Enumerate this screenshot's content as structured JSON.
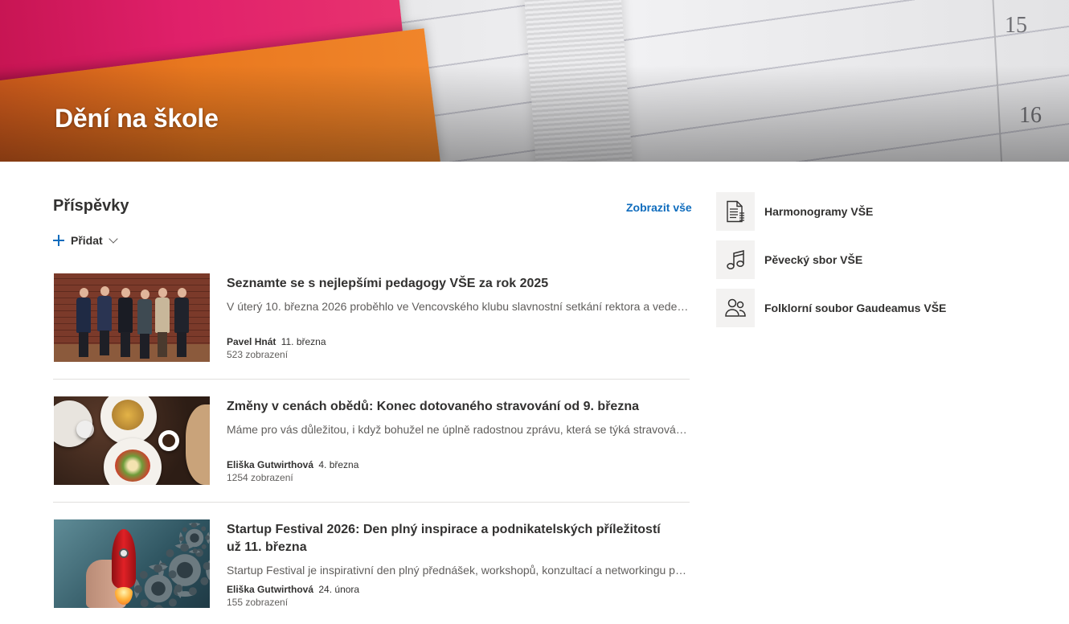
{
  "hero": {
    "title": "Dění na škole",
    "calendar_numbers": [
      "15",
      "16"
    ]
  },
  "news": {
    "title": "Příspěvky",
    "see_all": "Zobrazit vše",
    "add_label": "Přidat",
    "posts": [
      {
        "title": "Seznamte se s nejlepšími pedagogy VŠE za rok 2025",
        "description": "V úterý 10. března 2026 proběhlo ve Vencovského klubu slavnostní setkání rektora a vedení…",
        "author": "Pavel Hnát",
        "date": "11. března",
        "views": "523 zobrazení"
      },
      {
        "title": "Změny v cenách obědů: Konec dotovaného stravování od 9. března",
        "description": "Máme pro vás důležitou, i když bohužel ne úplně radostnou zprávu, která se týká stravování…",
        "author": "Eliška Gutwirthová",
        "date": "4. března",
        "views": "1254 zobrazení"
      },
      {
        "title": "Startup Festival 2026: Den plný inspirace a podnikatelských příležitostí už 11. března",
        "description": "Startup Festival je inspirativní den plný přednášek, workshopů, konzultací a networkingu pr…",
        "author": "Eliška Gutwirthová",
        "date": "24. února",
        "views": "155 zobrazení"
      }
    ]
  },
  "quick_links": [
    {
      "label": "Harmonogramy VŠE",
      "icon": "document-list-icon"
    },
    {
      "label": "Pěvecký sbor VŠE",
      "icon": "music-note-icon"
    },
    {
      "label": "Folklorní soubor Gaudeamus VŠE",
      "icon": "people-icon"
    }
  ],
  "colors": {
    "accent": "#0f6cbd",
    "text": "#323130",
    "secondary_text": "#605e5c",
    "divider": "#e1dfdd"
  }
}
